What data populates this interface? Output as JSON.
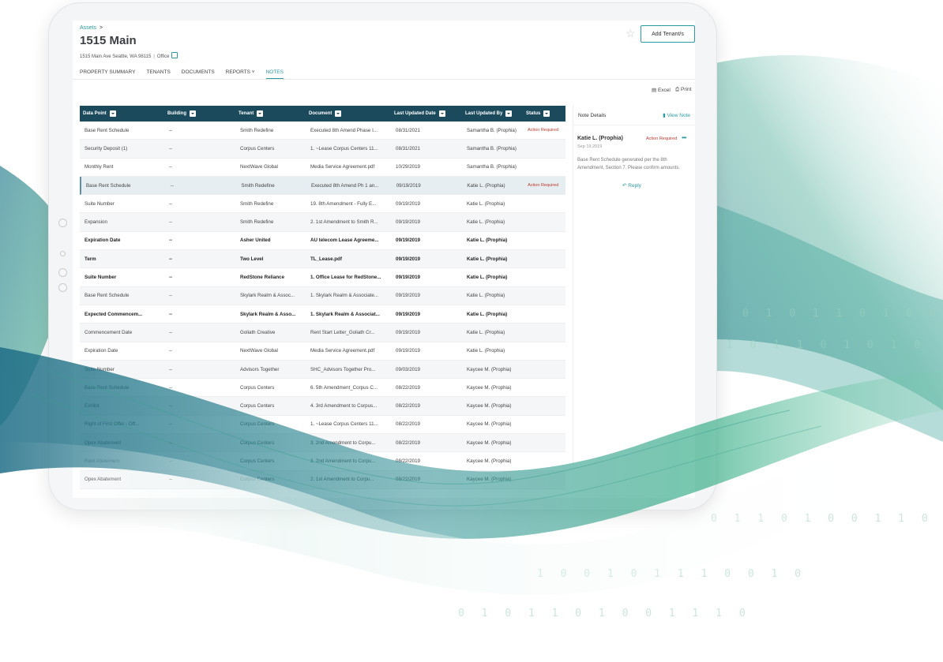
{
  "breadcrumb": {
    "label": "Assets",
    "chevron": ">"
  },
  "property": {
    "title": "1515 Main",
    "address": "1515 Main Ave Seattle, WA 98115",
    "type": "Office"
  },
  "header": {
    "add_button": "Add Tenant/s",
    "star_icon": "star-icon"
  },
  "tabs": [
    {
      "label": "PROPERTY SUMMARY"
    },
    {
      "label": "TENANTS"
    },
    {
      "label": "DOCUMENTS"
    },
    {
      "label": "REPORTS ˅"
    },
    {
      "label": "NOTES",
      "active": true
    }
  ],
  "export": {
    "excel": "Excel",
    "print": "Print"
  },
  "table": {
    "columns": [
      "Data Point",
      "Building",
      "Tenant",
      "Document",
      "Last Updated Date",
      "Last Updated By",
      "Status"
    ],
    "rows": [
      [
        "Base Rent Schedule",
        "--",
        "Smith Redefine",
        "Executed 8th Amend Phase I...",
        "08/31/2021",
        "Samantha B. (Prophia)",
        "Action Required"
      ],
      [
        "Security Deposit  (1)",
        "--",
        "Corpus Centers",
        "1. ~Lease Corpus Centers 11...",
        "08/31/2021",
        "Samantha B. (Prophia)",
        ""
      ],
      [
        "Monthly Rent",
        "--",
        "NextWave Global",
        "Media Service Agreement.pdf",
        "10/29/2019",
        "Samantha B. (Prophia)",
        ""
      ],
      [
        "Base Rent Schedule",
        "--",
        "Smith Redefine",
        "Executed 8th Amend Ph 1 an...",
        "09/19/2019",
        "Katie L. (Prophia)",
        "Action Required"
      ],
      [
        "Suite Number",
        "--",
        "Smith Redefine",
        "19. 8th Amendment - Fully E...",
        "09/19/2019",
        "Katie L. (Prophia)",
        ""
      ],
      [
        "Expansion",
        "--",
        "Smith Redefine",
        "2. 1st Amendment to Smith R...",
        "09/19/2019",
        "Katie L. (Prophia)",
        ""
      ],
      [
        "Expiration Date",
        "--",
        "Asher United",
        "AU telecom Lease Agreeme...",
        "09/19/2019",
        "Katie L. (Prophia)",
        ""
      ],
      [
        "Term",
        "--",
        "Two Level",
        "TL_Lease.pdf",
        "09/19/2019",
        "Katie L. (Prophia)",
        ""
      ],
      [
        "Suite Number",
        "--",
        "RedStone Reliance",
        "1. Office Lease for RedStone...",
        "09/19/2019",
        "Katie L. (Prophia)",
        ""
      ],
      [
        "Base Rent Schedule",
        "--",
        "Skylark Realm & Assoc...",
        "1. Skylark Realm & Associate...",
        "09/19/2019",
        "Katie L. (Prophia)",
        ""
      ],
      [
        "Expected Commencem...",
        "--",
        "Skylark Realm & Asso...",
        "1. Skylark Realm & Associat...",
        "09/19/2019",
        "Katie L. (Prophia)",
        ""
      ],
      [
        "Commencement Date",
        "--",
        "Goliath Creative",
        "Rent Start Letter_Goliath Cr...",
        "09/19/2019",
        "Katie L. (Prophia)",
        ""
      ],
      [
        "Expiration Date",
        "--",
        "NextWave Global",
        "Media Service Agreement.pdf",
        "09/19/2019",
        "Katie L. (Prophia)",
        ""
      ],
      [
        "Suite Number",
        "--",
        "Advisors Together",
        "SHC_Advisors Together Pro...",
        "09/03/2019",
        "Kaycee M. (Prophia)",
        ""
      ],
      [
        "Base Rent Schedule",
        "--",
        "Corpus Centers",
        "6. 5th Amendment_Corpus C...",
        "08/22/2019",
        "Kaycee M. (Prophia)",
        ""
      ],
      [
        "Exhibit",
        "--",
        "Corpus Centers",
        "4. 3rd Amendment to Corpus...",
        "08/22/2019",
        "Kaycee M. (Prophia)",
        ""
      ],
      [
        "Right of First Offer - Off...",
        "--",
        "Corpus Centers",
        "1. ~Lease Corpus Centers 11...",
        "08/22/2019",
        "Kaycee M. (Prophia)",
        ""
      ],
      [
        "Opex Abatement",
        "--",
        "Corpus Centers",
        "3. 2nd Amendment to Corpu...",
        "08/22/2019",
        "Kaycee M. (Prophia)",
        ""
      ],
      [
        "Rent Abatement",
        "--",
        "Corpus Centers",
        "3. 2nd Amendment to Corpu...",
        "08/22/2019",
        "Kaycee M. (Prophia)",
        ""
      ],
      [
        "Opex Abatement",
        "--",
        "Corpus Centers",
        "2. 1st Amendment to Corpu...",
        "08/22/2019",
        "Kaycee M. (Prophia)",
        ""
      ]
    ]
  },
  "note_details": {
    "heading": "Note Details",
    "view_note": "View Note",
    "author": "Katie L. (Prophia)",
    "date": "Sep 19,2019",
    "status": "Action Required",
    "body": "Base Rent Schedule generated per the 8th Amendment, Section 7. Please confirm amounts.",
    "reply": "Reply"
  },
  "bits": [
    "0 1 0 1 1 0 1 0 0 1",
    "1 0 1 1 0 1 0 1 0",
    "0 1 1 0 1 0 0 1 1 0 1",
    "1 0 0 1 0 1 1 1 0 0 1 0",
    "0 1 0 1 1 0 1 0 0 1 1 1 0"
  ],
  "colors": {
    "accent": "#2a9ba3",
    "header_bg": "#1b4a5c",
    "alert": "#c0392b"
  }
}
